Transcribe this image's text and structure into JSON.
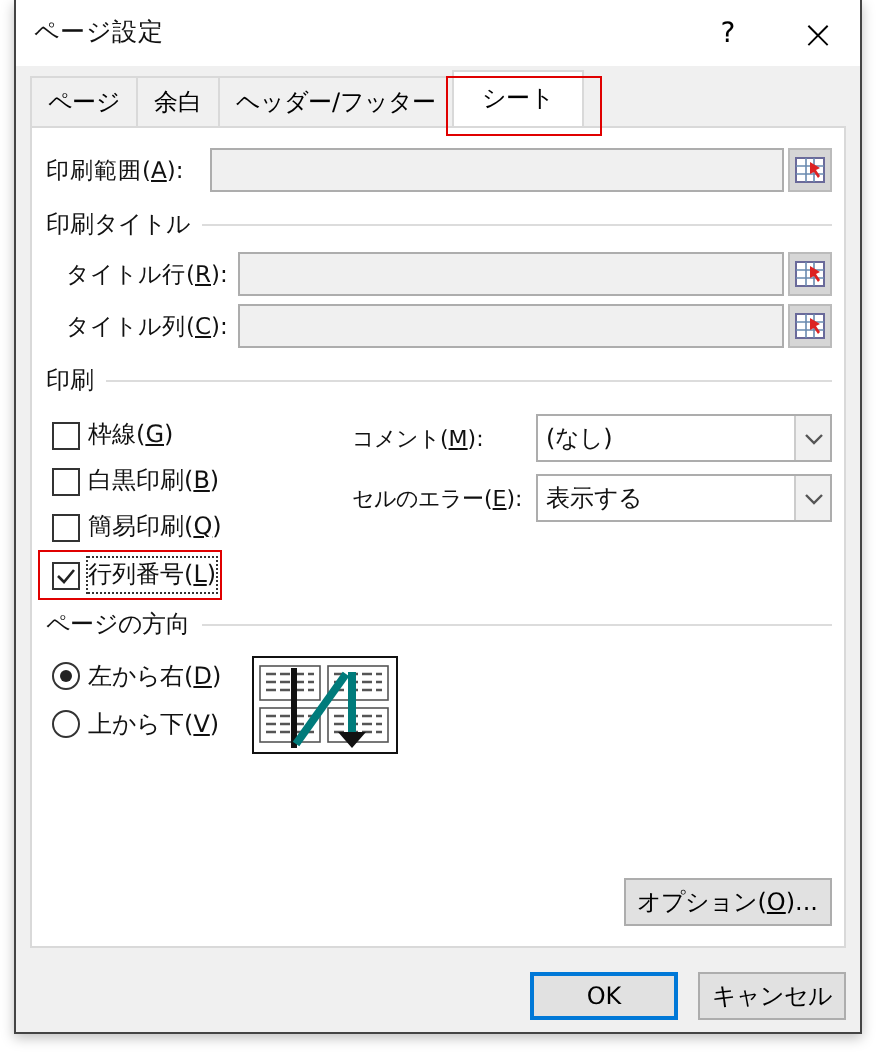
{
  "window": {
    "title": "ページ設定",
    "help_button": "?",
    "close_button": "×"
  },
  "tabs": [
    {
      "label": "ページ",
      "selected": false,
      "highlighted": false
    },
    {
      "label": "余白",
      "selected": false,
      "highlighted": false
    },
    {
      "label": "ヘッダー/フッター",
      "selected": false,
      "highlighted": false
    },
    {
      "label": "シート",
      "selected": true,
      "highlighted": true
    }
  ],
  "print_area": {
    "label": "印刷範囲(A):"
  },
  "print_titles": {
    "heading": "印刷タイトル",
    "fields": [
      {
        "label": "タイトル行(R):"
      },
      {
        "label": "タイトル列(C):"
      }
    ]
  },
  "print": {
    "heading": "印刷",
    "checkboxes": [
      {
        "label": "枠線(G)",
        "checked": false,
        "highlighted": false
      },
      {
        "label": "白黒印刷(B)",
        "checked": false,
        "highlighted": false
      },
      {
        "label": "簡易印刷(Q)",
        "checked": false,
        "highlighted": false
      },
      {
        "label": "行列番号(L)",
        "checked": true,
        "highlighted": true
      }
    ],
    "dropdowns": [
      {
        "label": "コメント(M):",
        "value": "(なし)"
      },
      {
        "label": "セルのエラー(E):",
        "value": "表示する"
      }
    ]
  },
  "page_order": {
    "heading": "ページの方向",
    "options": [
      {
        "label": "左から右(D)",
        "selected": true
      },
      {
        "label": "上から下(V)",
        "selected": false
      }
    ]
  },
  "options_button": "オプション(O)...",
  "buttons": [
    {
      "label": "OK",
      "default": true
    },
    {
      "label": "キャンセル",
      "default": false
    }
  ]
}
